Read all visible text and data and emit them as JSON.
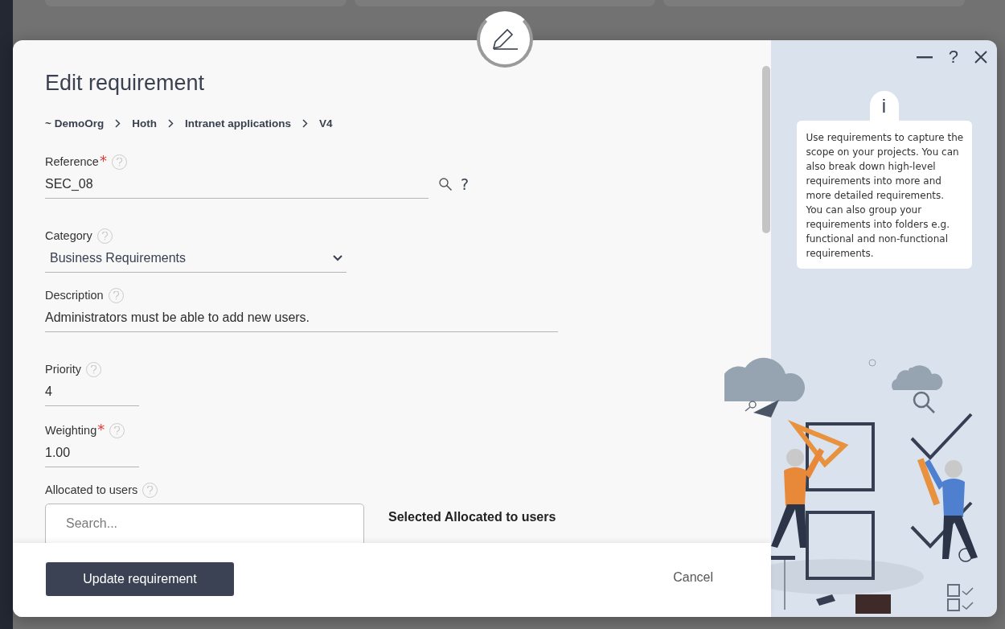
{
  "dialog": {
    "title": "Edit requirement",
    "breadcrumb": [
      "~ DemoOrg",
      "Hoth",
      "Intranet applications",
      "V4"
    ],
    "fields": [
      {
        "kind": "reference",
        "label": "Reference",
        "required_mark": "*",
        "value": "SEC_08",
        "lookup_help": "?"
      },
      {
        "kind": "select",
        "label": "Category",
        "value": "Business Requirements"
      },
      {
        "kind": "description",
        "label": "Description",
        "value": "Administrators must be able to add new users."
      },
      {
        "kind": "number",
        "label": "Priority",
        "value": "4"
      },
      {
        "kind": "number",
        "label": "Weighting",
        "required_mark": "*",
        "value": "1.00"
      },
      {
        "kind": "picker",
        "label": "Allocated to users",
        "placeholder": "Search...",
        "selected_heading": "Selected Allocated to users"
      }
    ],
    "window_help": "?",
    "info_badge": "i",
    "help_text": "Use requirements to capture the scope on your projects. You can also break down high-level requirements into more and more detailed requirements. You can also group your requirements into folders e.g. functional and non-functional requirements.",
    "primary_button": "Update requirement",
    "cancel_button": "Cancel"
  }
}
